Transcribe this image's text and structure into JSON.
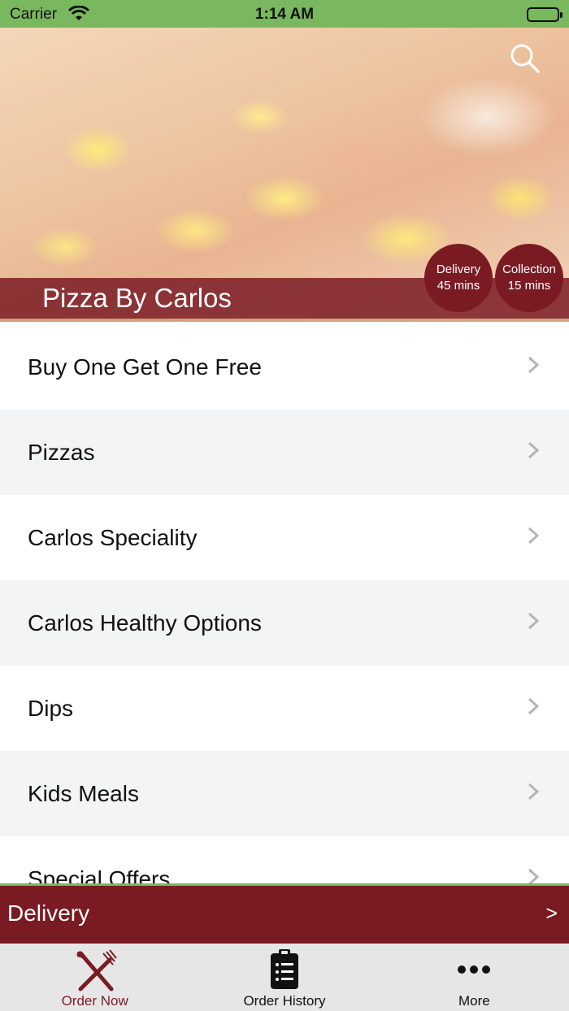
{
  "status_bar": {
    "carrier": "Carrier",
    "time": "1:14 AM"
  },
  "hero": {
    "restaurant_name": "Pizza By Carlos",
    "delivery_badge": {
      "label": "Delivery",
      "time": "45 mins"
    },
    "collection_badge": {
      "label": "Collection",
      "time": "15 mins"
    }
  },
  "menu": {
    "items": [
      {
        "label": "Buy One Get One Free"
      },
      {
        "label": "Pizzas"
      },
      {
        "label": "Carlos Speciality"
      },
      {
        "label": "Carlos Healthy Options"
      },
      {
        "label": "Dips"
      },
      {
        "label": "Kids Meals"
      },
      {
        "label": "Special Offers"
      }
    ]
  },
  "delivery_bar": {
    "label": "Delivery",
    "arrow": ">"
  },
  "tab_bar": {
    "tabs": [
      {
        "label": "Order Now",
        "icon": "fork-knife-icon",
        "active": true
      },
      {
        "label": "Order History",
        "icon": "clipboard-list-icon",
        "active": false
      },
      {
        "label": "More",
        "icon": "more-dots-icon",
        "active": false
      }
    ]
  },
  "colors": {
    "status_bar_bg": "#79b85e",
    "brand": "#7a1b24",
    "row_alt_bg": "#f3f4f6",
    "tab_bar_bg": "#e6e6e6"
  }
}
